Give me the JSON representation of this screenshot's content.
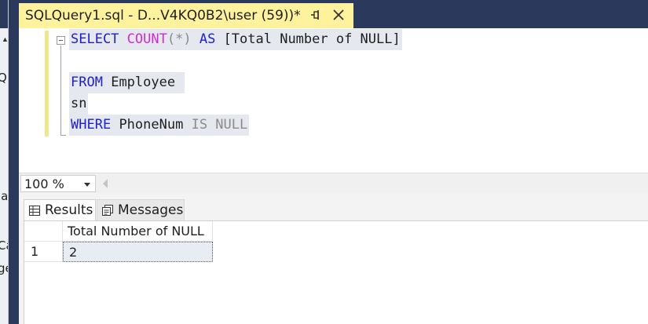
{
  "tab": {
    "title": "SQLQuery1.sql - D...V4KQ0B2\\user (59))*",
    "pin_icon": "pin-icon",
    "close_icon": "close-icon"
  },
  "left_strip": {
    "fragments": [
      "QL",
      "la",
      "Ca",
      "ge"
    ]
  },
  "editor": {
    "lines": [
      {
        "kw1": "SELECT",
        "fn": "COUNT",
        "op": "(*)",
        "kw2": "AS",
        "rest": "[Total Number of NULL]"
      },
      {
        "empty": ""
      },
      {
        "kw": "FROM",
        "rest": "Employee"
      },
      {
        "rest": "sn"
      },
      {
        "kw": "WHERE",
        "rest": "PhoneNum",
        "op": "IS NULL"
      }
    ]
  },
  "zoom": {
    "value": "100 %"
  },
  "results": {
    "tabs": [
      {
        "label": "Results",
        "icon": "grid-icon"
      },
      {
        "label": "Messages",
        "icon": "messages-icon"
      }
    ],
    "columns": [
      "Total Number of NULL"
    ],
    "rows": [
      {
        "num": "1",
        "values": [
          "2"
        ]
      }
    ]
  },
  "colors": {
    "tab_active": "#fff29d",
    "keyword": "#1e1ed2",
    "function": "#d22bd2",
    "operator": "#8a8a8a",
    "chrome_dark": "#2b3a5c"
  }
}
